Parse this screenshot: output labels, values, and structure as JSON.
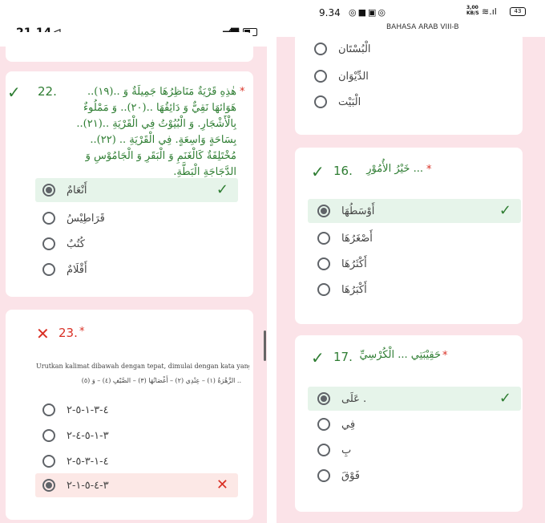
{
  "left": {
    "status": {
      "time": "21.14",
      "nav_glyph": "⊲",
      "network": "4G"
    },
    "q22": {
      "number": "22.",
      "required": "*",
      "text": "هٰذِهِ قَرْيَةٌ مَنَاظِرُهَا جَمِيلَةٌ وَ ..(١٩).. هَوَائهَا نَقِيٌّ وَ دَائِقُهَا ..(٢٠).. وَ مَمْلُوءٌ بِالْأَشْجَارِ. وَ الْبُيُوْتُ فِي الْقَرْيَةِ ..(٢١).. بِسَاحَةٍ وَاسِعَةٍ. فِي الْقَرْيَةِ .. (٢٢).. مُخْتَلِفَةٌ كَالْغَنَمِ وَ الْبَقَرِ وَ الْجَامُوْسِ وَ الدَّجَاجَةِ الْبَطَّةِ.",
      "options": [
        "أَنْعَامٌ",
        "قَرَاطِيْسُ",
        "كُتُبٌ",
        "أَقْلَامٌ"
      ]
    },
    "q23": {
      "number": "23.",
      "required": "*",
      "instruction": "Urutkan kalimat dibawah dengan tepat, dimulai dengan kata yang bergaris bawah!",
      "arabic_line": ".. الزَّهْرَةُ (١) – عِنْدِي (٢) – أَغْصَانُهَا (٣) – الصَّيْفِ (٤) – وَ (٥)",
      "options": [
        "٤-٣-١-٥-٢",
        "٣-١-٥-٤-٢",
        "٤-١-٣-٥-٢",
        "٣-٤-٥-١-٢"
      ]
    }
  },
  "right": {
    "status": {
      "time": "9.34",
      "title": "BAHASA ARAB VIII-B",
      "speed": "3,00 KB/S",
      "battery": "43"
    },
    "top_options": [
      "الْبُسْتَان",
      "الدِّيْوَان",
      "الْبَيْت"
    ],
    "q16": {
      "number": "16.",
      "required": "*",
      "text": "... خَيْرُ الأُمُوْرِ",
      "options": [
        "أَوْسَطُهَا",
        "أَصْغَرُهَا",
        "أَكْثَرُهَا",
        "أَكْبَرُهَا"
      ]
    },
    "q17": {
      "number": "17.",
      "required": "*",
      "text": "حَقِيْبَتِي ... الْكُرْسِيِّ",
      "options": [
        "عَلَى .",
        "فِي",
        "بِ",
        "فَوْقَ"
      ]
    }
  },
  "marks": {
    "correct": "✓",
    "wrong": "✕"
  },
  "colors": {
    "background": "#fbe3e8",
    "correct": "#2e7d32",
    "wrong": "#d93025",
    "correct_bg": "#e6f4ea",
    "wrong_bg": "#fce8e6"
  }
}
